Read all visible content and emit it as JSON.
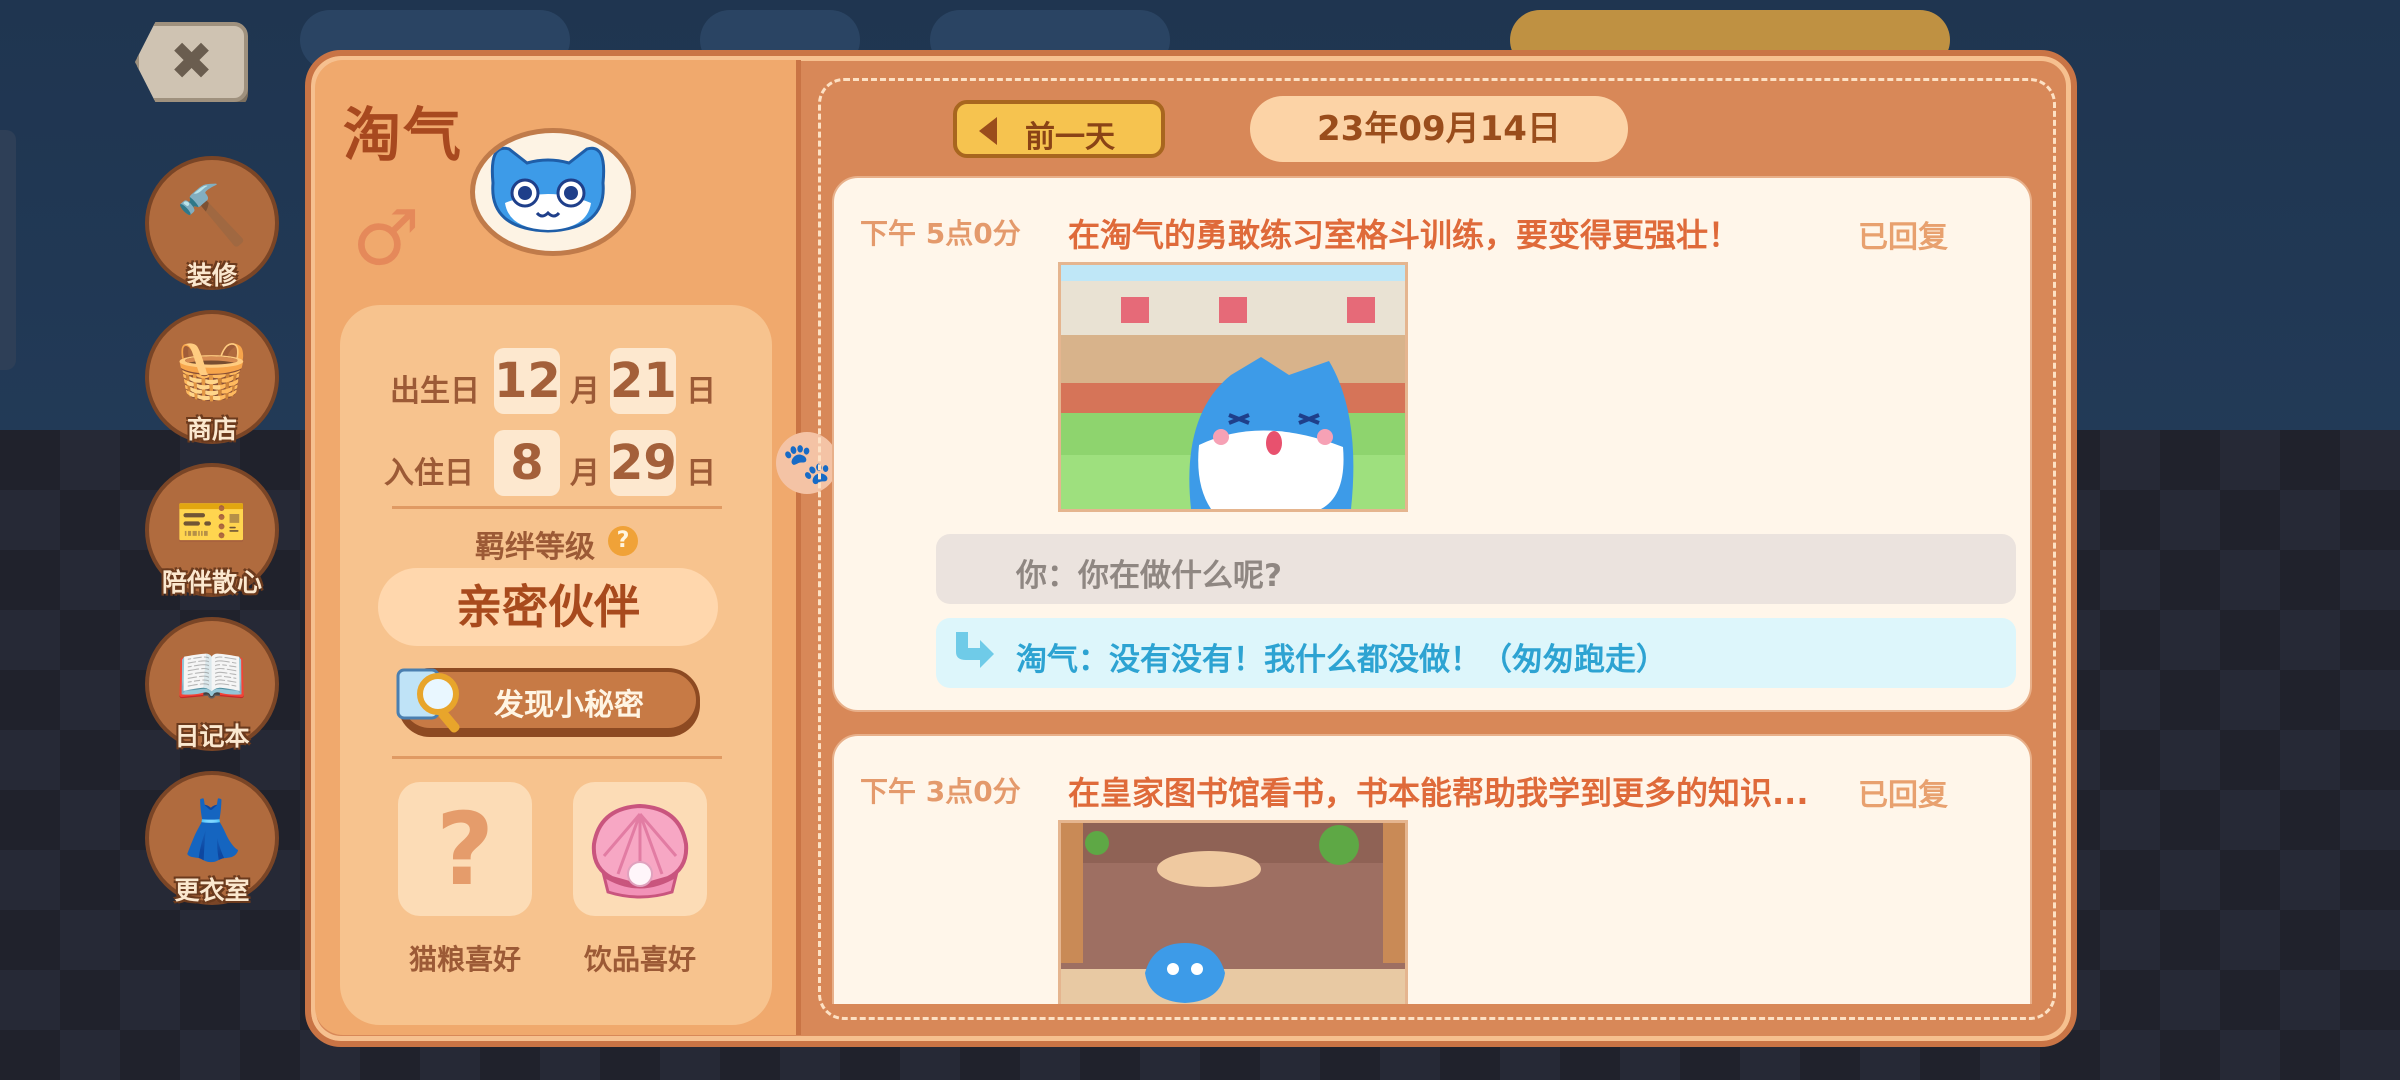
{
  "close_button": {
    "icon": "close-icon",
    "glyph": "✖"
  },
  "nav": [
    {
      "label": "装修",
      "icon": "hammer-icon",
      "glyph": "🔨"
    },
    {
      "label": "商店",
      "icon": "basket-icon",
      "glyph": "🧺"
    },
    {
      "label": "陪伴散心",
      "icon": "ticket-icon",
      "glyph": "🎫"
    },
    {
      "label": "日记本",
      "icon": "diary-icon",
      "glyph": "📖"
    },
    {
      "label": "更衣室",
      "icon": "wardrobe-icon",
      "glyph": "👗"
    }
  ],
  "profile": {
    "name": "淘气",
    "gender_symbol": "♂",
    "birthday": {
      "label": "出生日",
      "month": "12",
      "month_unit": "月",
      "day": "21",
      "day_unit": "日"
    },
    "move_in": {
      "label": "入住日",
      "month": "8",
      "month_unit": "月",
      "day": "29",
      "day_unit": "日"
    },
    "bond": {
      "label": "羁绊等级",
      "help": "?",
      "value": "亲密伙伴"
    },
    "secret_button": "发现小秘密",
    "food_pref": {
      "label": "猫粮喜好",
      "glyph": "?"
    },
    "drink_pref": {
      "label": "饮品喜好",
      "icon": "shell-icon",
      "glyph": "🐚"
    }
  },
  "diary": {
    "prev_button": "前一天",
    "date": "23年09月14日",
    "entries": [
      {
        "time": "下午 5点0分",
        "text": "在淘气的勇敢练习室格斗训练，要变得更强壮！",
        "status": "已回复",
        "you_reply": "你：你在做什么呢?",
        "cat_reply": "淘气：没有没有！我什么都没做！（匆匆跑走）"
      },
      {
        "time": "下午 3点0分",
        "text": "在皇家图书馆看书，书本能帮助我学到更多的知识...",
        "status": "已回复"
      }
    ]
  },
  "colors": {
    "panel": "#d88858",
    "left_column": "#f0a96d",
    "accent_orange": "#df6a3a",
    "reply_cyan_bg": "#ddf6fb",
    "reply_cyan_text": "#2da3d2",
    "you_bubble_bg": "#ebe3de"
  }
}
